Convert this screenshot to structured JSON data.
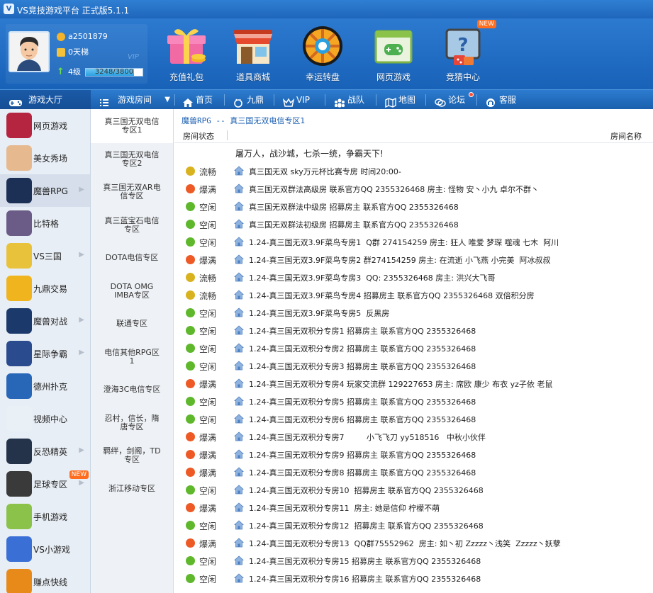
{
  "window": {
    "title": "VS竞技游戏平台 正式版5.1.1"
  },
  "user": {
    "name": "a2501879",
    "ladder": "0天梯",
    "vip": "VIP",
    "level": "4级",
    "exp": "3248/3800",
    "exp_fraction": 0.854
  },
  "header_icons": [
    {
      "label": "充值礼包"
    },
    {
      "label": "道具商城"
    },
    {
      "label": "幸运转盘"
    },
    {
      "label": "网页游戏"
    },
    {
      "label": "竞猜中心",
      "badge": "NEW"
    }
  ],
  "nav": {
    "game_hall": "游戏大厅",
    "game_room": "游戏房间",
    "items": [
      "首页",
      "九鼎",
      "VIP",
      "战队",
      "地图",
      "论坛",
      "客服"
    ]
  },
  "sidebar": [
    {
      "label": "网页游戏"
    },
    {
      "label": "美女秀场"
    },
    {
      "label": "魔兽RPG",
      "arrow": "▶"
    },
    {
      "label": "比特格"
    },
    {
      "label": "VS三国",
      "arrow": "▶"
    },
    {
      "label": "九鼎交易"
    },
    {
      "label": "魔兽对战",
      "arrow": "▶"
    },
    {
      "label": "星际争霸",
      "arrow": "▶"
    },
    {
      "label": "德州扑克"
    },
    {
      "label": "视频中心"
    },
    {
      "label": "反恐精英",
      "arrow": "▶"
    },
    {
      "label": "足球专区",
      "arrow": "▶",
      "badge": "NEW"
    },
    {
      "label": "手机游戏"
    },
    {
      "label": "VS小游戏"
    },
    {
      "label": "赚点快线"
    }
  ],
  "zones": [
    "真三国无双电信专区1",
    "真三国无双电信专区2",
    "真三国无双AR电信专区",
    "真三蓝宝石电信专区",
    "DOTA电信专区",
    "DOTA OMG IMBA专区",
    "联通专区",
    "电信其他RPG区1",
    "澄海3C电信专区",
    "忍村，信长，隋唐专区",
    "羁绊，剑阁，TD专区",
    "浙江移动专区"
  ],
  "main": {
    "breadcrumb": "魔兽RPG -- 真三国无双电信专区1",
    "col_status": "房间状态",
    "col_name": "房间名称",
    "announcement": "屠万人，战沙城，七杀一统，争霸天下!",
    "status_colors": {
      "流畅": "#d9b21f",
      "爆满": "#ee5a25",
      "空闲": "#5fb82c"
    },
    "rooms": [
      {
        "status": "流畅",
        "name": "真三国无双 sky万元杯比赛专房 时间20:00-"
      },
      {
        "status": "爆满",
        "name": "真三国无双群法高级房 联系官方QQ 2355326468 房主: 怪物 安丶小九 卓尔不群丶"
      },
      {
        "status": "空闲",
        "name": "真三国无双群法中级房 招募房主 联系官方QQ 2355326468"
      },
      {
        "status": "空闲",
        "name": "真三国无双群法初级房 招募房主 联系官方QQ 2355326468"
      },
      {
        "status": "空闲",
        "name": "1.24-真三国无双3.9F菜鸟专房1  Q群 274154259 房主: 狂人 唯爱 梦琛 噬魂 七木  阿川"
      },
      {
        "status": "爆满",
        "name": "1.24-真三国无双3.9F菜鸟专房2 群274154259 房主: 在流逝 小飞燕 小完美  阿冰叔叔"
      },
      {
        "status": "流畅",
        "name": "1.24-真三国无双3.9F菜鸟专房3  QQ: 2355326468 房主: 洪兴大飞哥"
      },
      {
        "status": "流畅",
        "name": "1.24-真三国无双3.9F菜鸟专房4 招募房主 联系官方QQ 2355326468 双倍积分房"
      },
      {
        "status": "空闲",
        "name": "1.24-真三国无双3.9F菜鸟专房5  反黑房"
      },
      {
        "status": "空闲",
        "name": "1.24-真三国无双积分专房1 招募房主 联系官方QQ 2355326468"
      },
      {
        "status": "空闲",
        "name": "1.24-真三国无双积分专房2 招募房主 联系官方QQ 2355326468"
      },
      {
        "status": "空闲",
        "name": "1.24-真三国无双积分专房3 招募房主 联系官方QQ 2355326468"
      },
      {
        "status": "爆满",
        "name": "1.24-真三国无双积分专房4 玩家交流群 129227653 房主: 席欧 康少 布衣 yz子依 老鼠"
      },
      {
        "status": "空闲",
        "name": "1.24-真三国无双积分专房5 招募房主 联系官方QQ 2355326468"
      },
      {
        "status": "空闲",
        "name": "1.24-真三国无双积分专房6 招募房主 联系官方QQ 2355326468"
      },
      {
        "status": "爆满",
        "name": "1.24-真三国无双积分专房7         小飞飞刀 yy518516   中秋小伙伴"
      },
      {
        "status": "爆满",
        "name": "1.24-真三国无双积分专房9 招募房主 联系官方QQ 2355326468"
      },
      {
        "status": "爆满",
        "name": "1.24-真三国无双积分专房8 招募房主 联系官方QQ 2355326468"
      },
      {
        "status": "空闲",
        "name": "1.24-真三国无双积分专房10  招募房主 联系官方QQ 2355326468"
      },
      {
        "status": "爆满",
        "name": "1.24-真三国无双积分专房11  房主: 她是信仰 柠檬不萌"
      },
      {
        "status": "空闲",
        "name": "1.24-真三国无双积分专房12  招募房主 联系官方QQ 2355326468"
      },
      {
        "status": "爆满",
        "name": "1.24-真三国无双积分专房13  QQ群75552962  房主: 如丶初 Zzzzz丶浅笑  Zzzzz丶妖孽"
      },
      {
        "status": "空闲",
        "name": "1.24-真三国无双积分专房15 招募房主 联系官方QQ 2355326468"
      },
      {
        "status": "空闲",
        "name": "1.24-真三国无双积分专房16 招募房主 联系官方QQ 2355326468"
      }
    ]
  }
}
